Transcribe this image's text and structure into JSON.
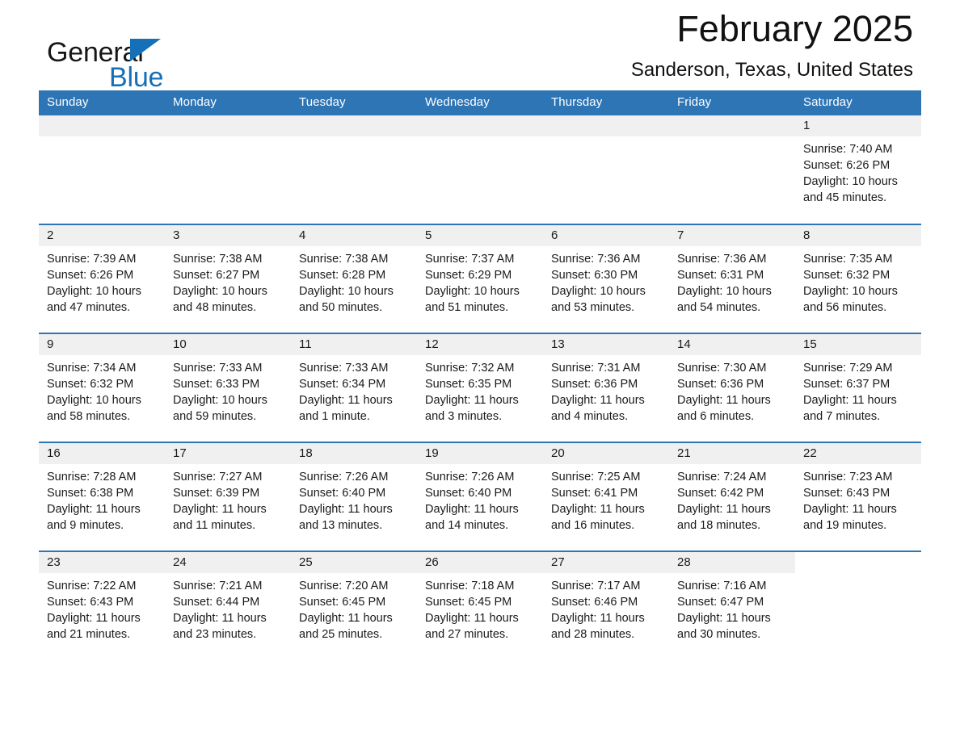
{
  "brand": {
    "name_part1": "General",
    "name_part2": "Blue",
    "logo_icon": "triangle-icon",
    "accent_color": "#1570b8"
  },
  "header": {
    "title": "February 2025",
    "subtitle": "Sanderson, Texas, United States"
  },
  "theme": {
    "header_bg": "#2e75b6",
    "daynum_bg": "#f0f0f0",
    "rule_color": "#2e75b6",
    "text_color": "#1a1a1a"
  },
  "weekdays": [
    "Sunday",
    "Monday",
    "Tuesday",
    "Wednesday",
    "Thursday",
    "Friday",
    "Saturday"
  ],
  "labels": {
    "sunrise_prefix": "Sunrise:",
    "sunset_prefix": "Sunset:",
    "daylight_prefix": "Daylight:"
  },
  "weeks": [
    [
      {
        "blank": true
      },
      {
        "blank": true
      },
      {
        "blank": true
      },
      {
        "blank": true
      },
      {
        "blank": true
      },
      {
        "blank": true
      },
      {
        "day": "1",
        "sunrise": "Sunrise: 7:40 AM",
        "sunset": "Sunset: 6:26 PM",
        "daylight_line1": "Daylight: 10 hours",
        "daylight_line2": "and 45 minutes."
      }
    ],
    [
      {
        "day": "2",
        "sunrise": "Sunrise: 7:39 AM",
        "sunset": "Sunset: 6:26 PM",
        "daylight_line1": "Daylight: 10 hours",
        "daylight_line2": "and 47 minutes."
      },
      {
        "day": "3",
        "sunrise": "Sunrise: 7:38 AM",
        "sunset": "Sunset: 6:27 PM",
        "daylight_line1": "Daylight: 10 hours",
        "daylight_line2": "and 48 minutes."
      },
      {
        "day": "4",
        "sunrise": "Sunrise: 7:38 AM",
        "sunset": "Sunset: 6:28 PM",
        "daylight_line1": "Daylight: 10 hours",
        "daylight_line2": "and 50 minutes."
      },
      {
        "day": "5",
        "sunrise": "Sunrise: 7:37 AM",
        "sunset": "Sunset: 6:29 PM",
        "daylight_line1": "Daylight: 10 hours",
        "daylight_line2": "and 51 minutes."
      },
      {
        "day": "6",
        "sunrise": "Sunrise: 7:36 AM",
        "sunset": "Sunset: 6:30 PM",
        "daylight_line1": "Daylight: 10 hours",
        "daylight_line2": "and 53 minutes."
      },
      {
        "day": "7",
        "sunrise": "Sunrise: 7:36 AM",
        "sunset": "Sunset: 6:31 PM",
        "daylight_line1": "Daylight: 10 hours",
        "daylight_line2": "and 54 minutes."
      },
      {
        "day": "8",
        "sunrise": "Sunrise: 7:35 AM",
        "sunset": "Sunset: 6:32 PM",
        "daylight_line1": "Daylight: 10 hours",
        "daylight_line2": "and 56 minutes."
      }
    ],
    [
      {
        "day": "9",
        "sunrise": "Sunrise: 7:34 AM",
        "sunset": "Sunset: 6:32 PM",
        "daylight_line1": "Daylight: 10 hours",
        "daylight_line2": "and 58 minutes."
      },
      {
        "day": "10",
        "sunrise": "Sunrise: 7:33 AM",
        "sunset": "Sunset: 6:33 PM",
        "daylight_line1": "Daylight: 10 hours",
        "daylight_line2": "and 59 minutes."
      },
      {
        "day": "11",
        "sunrise": "Sunrise: 7:33 AM",
        "sunset": "Sunset: 6:34 PM",
        "daylight_line1": "Daylight: 11 hours",
        "daylight_line2": "and 1 minute."
      },
      {
        "day": "12",
        "sunrise": "Sunrise: 7:32 AM",
        "sunset": "Sunset: 6:35 PM",
        "daylight_line1": "Daylight: 11 hours",
        "daylight_line2": "and 3 minutes."
      },
      {
        "day": "13",
        "sunrise": "Sunrise: 7:31 AM",
        "sunset": "Sunset: 6:36 PM",
        "daylight_line1": "Daylight: 11 hours",
        "daylight_line2": "and 4 minutes."
      },
      {
        "day": "14",
        "sunrise": "Sunrise: 7:30 AM",
        "sunset": "Sunset: 6:36 PM",
        "daylight_line1": "Daylight: 11 hours",
        "daylight_line2": "and 6 minutes."
      },
      {
        "day": "15",
        "sunrise": "Sunrise: 7:29 AM",
        "sunset": "Sunset: 6:37 PM",
        "daylight_line1": "Daylight: 11 hours",
        "daylight_line2": "and 7 minutes."
      }
    ],
    [
      {
        "day": "16",
        "sunrise": "Sunrise: 7:28 AM",
        "sunset": "Sunset: 6:38 PM",
        "daylight_line1": "Daylight: 11 hours",
        "daylight_line2": "and 9 minutes."
      },
      {
        "day": "17",
        "sunrise": "Sunrise: 7:27 AM",
        "sunset": "Sunset: 6:39 PM",
        "daylight_line1": "Daylight: 11 hours",
        "daylight_line2": "and 11 minutes."
      },
      {
        "day": "18",
        "sunrise": "Sunrise: 7:26 AM",
        "sunset": "Sunset: 6:40 PM",
        "daylight_line1": "Daylight: 11 hours",
        "daylight_line2": "and 13 minutes."
      },
      {
        "day": "19",
        "sunrise": "Sunrise: 7:26 AM",
        "sunset": "Sunset: 6:40 PM",
        "daylight_line1": "Daylight: 11 hours",
        "daylight_line2": "and 14 minutes."
      },
      {
        "day": "20",
        "sunrise": "Sunrise: 7:25 AM",
        "sunset": "Sunset: 6:41 PM",
        "daylight_line1": "Daylight: 11 hours",
        "daylight_line2": "and 16 minutes."
      },
      {
        "day": "21",
        "sunrise": "Sunrise: 7:24 AM",
        "sunset": "Sunset: 6:42 PM",
        "daylight_line1": "Daylight: 11 hours",
        "daylight_line2": "and 18 minutes."
      },
      {
        "day": "22",
        "sunrise": "Sunrise: 7:23 AM",
        "sunset": "Sunset: 6:43 PM",
        "daylight_line1": "Daylight: 11 hours",
        "daylight_line2": "and 19 minutes."
      }
    ],
    [
      {
        "day": "23",
        "sunrise": "Sunrise: 7:22 AM",
        "sunset": "Sunset: 6:43 PM",
        "daylight_line1": "Daylight: 11 hours",
        "daylight_line2": "and 21 minutes."
      },
      {
        "day": "24",
        "sunrise": "Sunrise: 7:21 AM",
        "sunset": "Sunset: 6:44 PM",
        "daylight_line1": "Daylight: 11 hours",
        "daylight_line2": "and 23 minutes."
      },
      {
        "day": "25",
        "sunrise": "Sunrise: 7:20 AM",
        "sunset": "Sunset: 6:45 PM",
        "daylight_line1": "Daylight: 11 hours",
        "daylight_line2": "and 25 minutes."
      },
      {
        "day": "26",
        "sunrise": "Sunrise: 7:18 AM",
        "sunset": "Sunset: 6:45 PM",
        "daylight_line1": "Daylight: 11 hours",
        "daylight_line2": "and 27 minutes."
      },
      {
        "day": "27",
        "sunrise": "Sunrise: 7:17 AM",
        "sunset": "Sunset: 6:46 PM",
        "daylight_line1": "Daylight: 11 hours",
        "daylight_line2": "and 28 minutes."
      },
      {
        "day": "28",
        "sunrise": "Sunrise: 7:16 AM",
        "sunset": "Sunset: 6:47 PM",
        "daylight_line1": "Daylight: 11 hours",
        "daylight_line2": "and 30 minutes."
      },
      {
        "blank": true,
        "nofill": true
      }
    ]
  ]
}
